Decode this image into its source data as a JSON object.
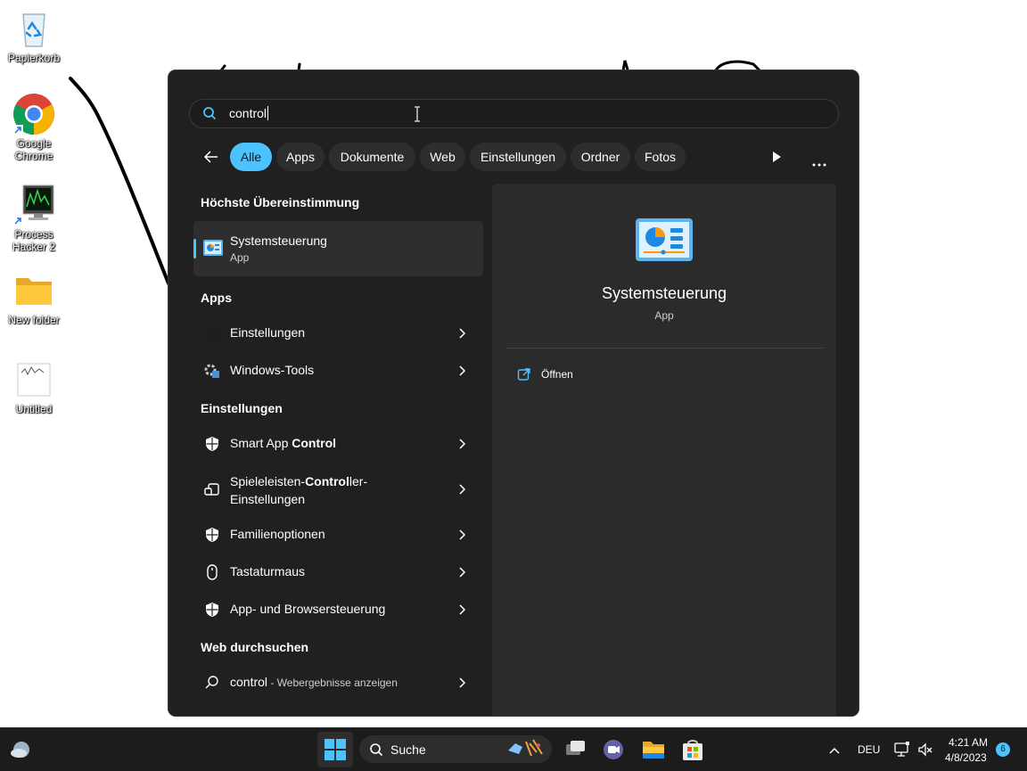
{
  "desktop": {
    "icons": [
      {
        "label": "Papierkorb"
      },
      {
        "label": "Google Chrome"
      },
      {
        "label": "Process Hacker 2"
      },
      {
        "label": "New folder"
      },
      {
        "label": "Untitled"
      }
    ]
  },
  "search": {
    "query": "control"
  },
  "filters": {
    "chips": [
      "Alle",
      "Apps",
      "Dokumente",
      "Web",
      "Einstellungen",
      "Ordner",
      "Fotos"
    ],
    "active": "Alle"
  },
  "results": {
    "best_match_title": "Höchste Übereinstimmung",
    "best_match": {
      "name": "Systemsteuerung",
      "type": "App"
    },
    "apps_title": "Apps",
    "apps": [
      "Einstellungen",
      "Windows-Tools"
    ],
    "settings_title": "Einstellungen",
    "settings": {
      "smart_app_prefix": "Smart App ",
      "smart_app_bold": "Control",
      "game_controller_prefix": "Spieleleisten-",
      "game_controller_bold": "Control",
      "game_controller_suffix": "ler-",
      "game_controller_line2": "Einstellungen",
      "family": "Familienoptionen",
      "mouse": "Tastaturmaus",
      "app_browser": "App- und Browsersteuerung"
    },
    "web_title": "Web durchsuchen",
    "web": {
      "query": "control",
      "hint": " - Webergebnisse anzeigen"
    }
  },
  "preview": {
    "name": "Systemsteuerung",
    "type": "App",
    "action_open": "Öffnen"
  },
  "taskbar": {
    "search_label": "Suche",
    "language": "DEU",
    "time": "4:21 AM",
    "date": "4/8/2023",
    "notification_count": "6"
  },
  "colors": {
    "accent": "#4cc2ff",
    "panel_bg": "#202020",
    "preview_bg": "#2b2b2b",
    "taskbar_bg": "#1c1c1c"
  }
}
